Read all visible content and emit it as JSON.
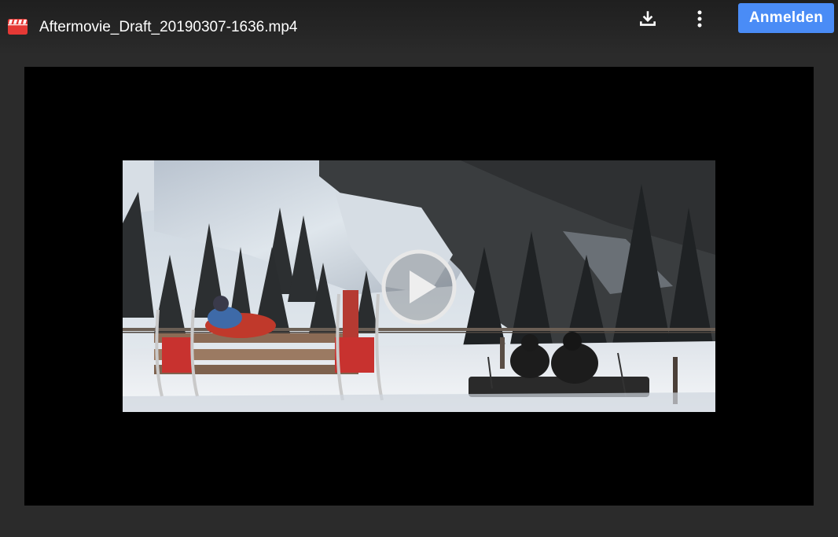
{
  "header": {
    "file_name": "Aftermovie_Draft_20190307-1636.mp4",
    "file_icon": "video-file-icon",
    "download_icon": "download-icon",
    "more_icon": "more-vertical-icon",
    "signin_label": "Anmelden"
  },
  "player": {
    "play_icon": "play-icon"
  },
  "colors": {
    "accent": "#4a8cf6",
    "file_icon": "#e53935",
    "background": "#2b2b2b",
    "player_background": "#000000"
  }
}
